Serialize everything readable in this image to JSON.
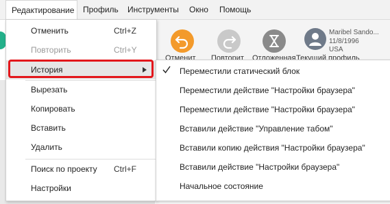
{
  "menubar": {
    "items": [
      {
        "label": "Редактирование"
      },
      {
        "label": "Профиль"
      },
      {
        "label": "Инструменты"
      },
      {
        "label": "Окно"
      },
      {
        "label": "Помощь"
      }
    ]
  },
  "toolbar": {
    "buttons": [
      {
        "label": "Отменит",
        "icon": "undo-icon",
        "color": "#f39a2b"
      },
      {
        "label": "Повторит",
        "icon": "redo-icon",
        "color": "#c9c9c9"
      },
      {
        "label": "Отложенная",
        "icon": "hourglass-icon",
        "color": "#8a8a8a"
      },
      {
        "label": "Текущий профиль",
        "icon": "user-avatar-icon",
        "color": "#6f7a89"
      }
    ],
    "user": {
      "name": "Maribel Sando...",
      "date": "11/8/1996",
      "country": "USA"
    }
  },
  "edit_menu": {
    "items": [
      {
        "label": "Отменить",
        "shortcut": "Ctrl+Z",
        "enabled": true
      },
      {
        "label": "Повторить",
        "shortcut": "Ctrl+Y",
        "enabled": false
      },
      {
        "label": "История",
        "submenu": true,
        "enabled": true
      },
      {
        "label": "Вырезать",
        "enabled": true
      },
      {
        "label": "Копировать",
        "enabled": true
      },
      {
        "label": "Вставить",
        "enabled": true
      },
      {
        "label": "Удалить",
        "enabled": true
      },
      {
        "label": "Поиск по проекту",
        "shortcut": "Ctrl+F",
        "enabled": true
      },
      {
        "label": "Настройки",
        "enabled": true
      }
    ]
  },
  "history_submenu": {
    "items": [
      {
        "label": "Переместили статический блок",
        "checked": true
      },
      {
        "label": "Переместили действие \"Настройки браузера\""
      },
      {
        "label": "Переместили действие \"Настройки браузера\""
      },
      {
        "label": "Вставили действие \"Управление табом\""
      },
      {
        "label": "Вставили копию действия \"Настройки браузера\""
      },
      {
        "label": "Вставили действие \"Настройки браузера\""
      },
      {
        "label": "Начальное состояние"
      }
    ]
  },
  "colors": {
    "highlight_outline": "#e3161b",
    "accent_green": "#23b08a"
  }
}
